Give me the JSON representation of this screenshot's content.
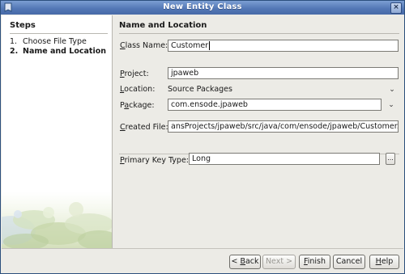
{
  "window": {
    "title": "New Entity Class"
  },
  "steps": {
    "heading": "Steps",
    "items": [
      {
        "num": "1.",
        "label": "Choose File Type",
        "active": false
      },
      {
        "num": "2.",
        "label": "Name and Location",
        "active": true
      }
    ]
  },
  "section": {
    "heading": "Name and Location"
  },
  "form": {
    "class_name_label": "Class Name:",
    "class_name_value": "Customer",
    "project_label": "Project:",
    "project_value": "jpaweb",
    "location_label": "Location:",
    "location_value": "Source Packages",
    "package_label": "Package:",
    "package_value": "com.ensode.jpaweb",
    "created_file_label": "Created File:",
    "created_file_value": "ansProjects/jpaweb/src/java/com/ensode/jpaweb/Customer.java",
    "pk_label": "Primary Key Type:",
    "pk_value": "Long",
    "browse_label": "..."
  },
  "buttons": {
    "back": "< Back",
    "next": "Next >",
    "finish": "Finish",
    "cancel": "Cancel",
    "help": "Help"
  },
  "icons": {
    "window": "window-app-icon",
    "close": "close-icon",
    "dropdown": "chevron-down-icon"
  }
}
